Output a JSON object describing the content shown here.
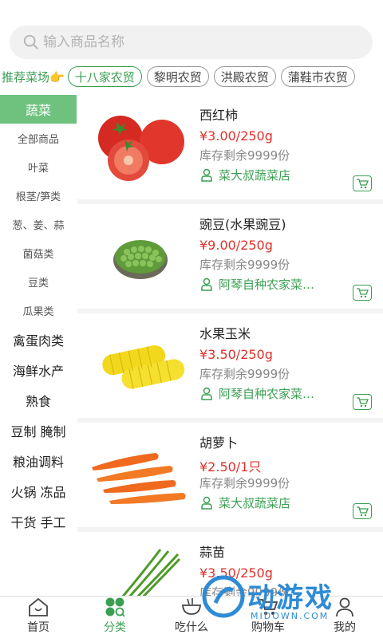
{
  "search": {
    "placeholder": "输入商品名称"
  },
  "markets": {
    "prefix": "推荐菜场👉",
    "items": [
      "十八家农贸",
      "黎明农贸",
      "洪殿农贸",
      "蒲鞋市农贸"
    ]
  },
  "sidebar": {
    "items": [
      "蔬菜",
      "全部商品",
      "叶菜",
      "根茎/笋类",
      "葱、姜、蒜",
      "菌菇类",
      "豆类",
      "瓜果类",
      "禽蛋肉类",
      "海鲜水产",
      "熟食",
      "豆制 腌制",
      "粮油调料",
      "火锅 冻品",
      "干货 手工"
    ]
  },
  "products": [
    {
      "name": "西红柿",
      "price": "¥3.00/250g",
      "stock": "库存剩余9999份",
      "shop": "菜大叔蔬菜店"
    },
    {
      "name": "豌豆(水果豌豆)",
      "price": "¥9.00/250g",
      "stock": "库存剩余9999份",
      "shop": "阿琴自种农家菜…"
    },
    {
      "name": "水果玉米",
      "price": "¥3.50/250g",
      "stock": "库存剩余9999份",
      "shop": "阿琴自种农家菜…"
    },
    {
      "name": "胡萝卜",
      "price": "¥2.50/1只",
      "stock": "库存剩余9999份",
      "shop": "菜大叔蔬菜店"
    },
    {
      "name": "蒜苗",
      "price": "¥3.50/250g",
      "stock": "库存剩余9999份",
      "shop": ""
    }
  ],
  "tabbar": {
    "home": "首页",
    "category": "分类",
    "eat": "吃什么",
    "cart": "购物车",
    "mine": "我的"
  },
  "watermark": {
    "text": "动游戏",
    "sub": "MIDOWN.COM"
  },
  "colors": {
    "accent": "#3a9f52",
    "sidebar_active": "#6ec27e",
    "price": "#e0302a"
  }
}
